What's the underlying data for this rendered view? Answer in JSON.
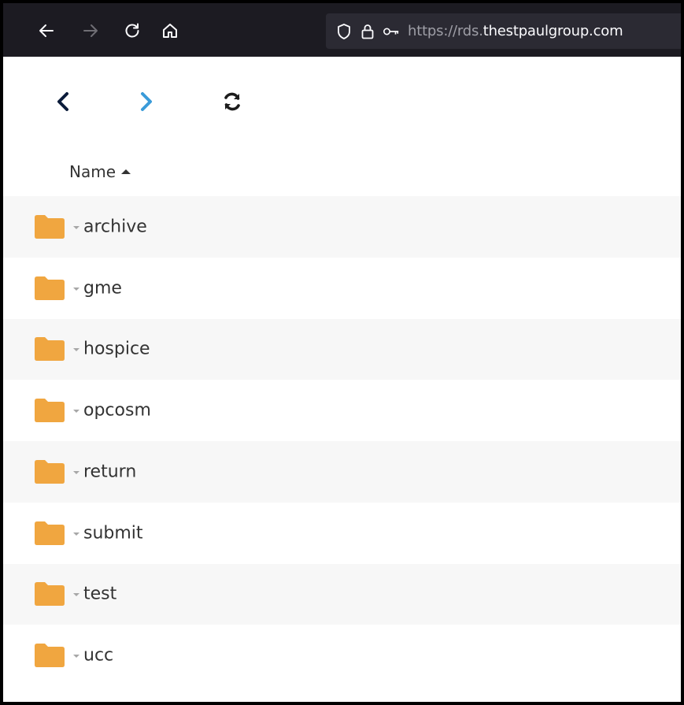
{
  "browser": {
    "url_scheme": "https://rds.",
    "url_host": "thestpaulgroup.com",
    "icons": [
      "back-arrow-icon",
      "forward-arrow-icon",
      "reload-icon",
      "home-icon",
      "shield-icon",
      "lock-icon",
      "key-icon"
    ],
    "colors": {
      "toolbar": "#1c1b22",
      "urlbar": "#2b2a33"
    }
  },
  "appnav": {
    "icons": [
      "chevron-left-icon",
      "chevron-right-icon",
      "refresh-icon"
    ],
    "colors": {
      "back": "#0b1c3a",
      "forward": "#3a9bd9",
      "refresh": "#1c1c1c"
    }
  },
  "table": {
    "header": {
      "name": "Name",
      "sort": "ascending"
    },
    "rows": [
      {
        "name": "archive"
      },
      {
        "name": "gme"
      },
      {
        "name": "hospice"
      },
      {
        "name": "opcosm"
      },
      {
        "name": "return"
      },
      {
        "name": "submit"
      },
      {
        "name": "test"
      },
      {
        "name": "ucc"
      }
    ],
    "folder_color": "#f0a640"
  }
}
